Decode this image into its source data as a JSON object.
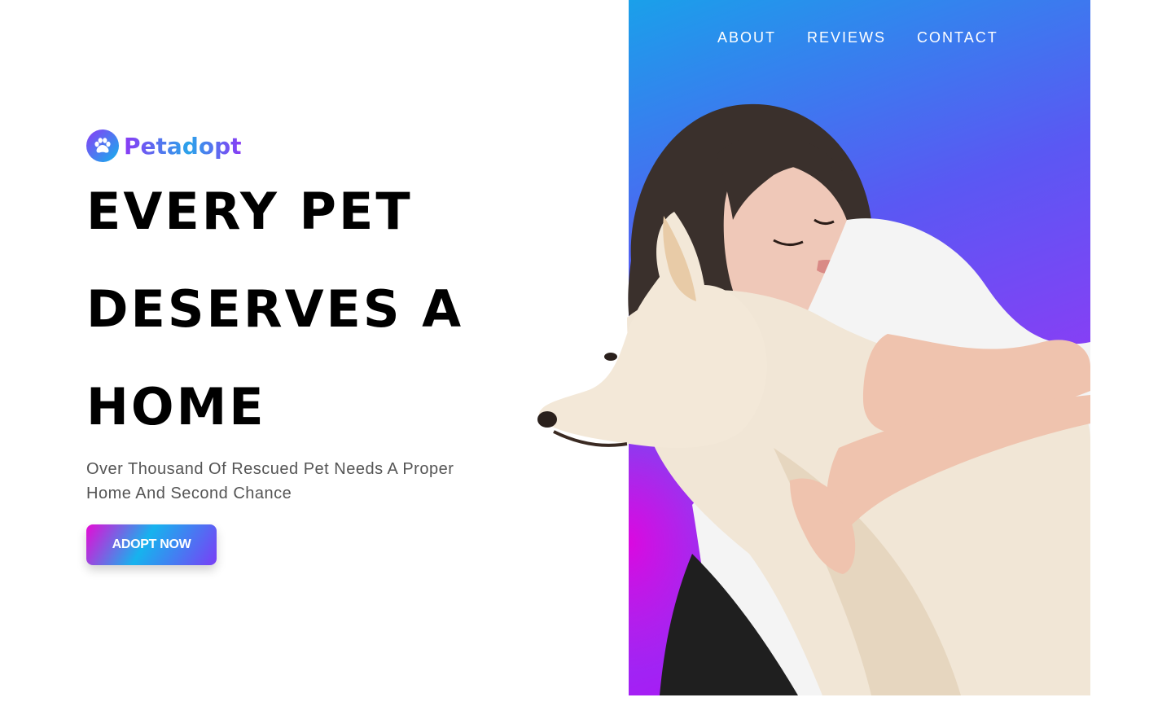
{
  "nav": {
    "items": [
      {
        "label": "ABOUT"
      },
      {
        "label": "REVIEWS"
      },
      {
        "label": "CONTACT"
      }
    ]
  },
  "brand": {
    "name": "Petadopt",
    "icon": "paw-icon"
  },
  "hero": {
    "headline_lines": [
      "EVERY PET",
      "DESERVES A",
      "HOME"
    ],
    "subtitle": "Over Thousand Of Rescued Pet Needs A Proper Home And Second Chance",
    "cta_label": "ADOPT NOW"
  },
  "colors": {
    "accent_purple": "#8a3af5",
    "accent_blue": "#16b3ee",
    "accent_magenta": "#e60ad6",
    "headline": "#000000",
    "subtitle": "#555555"
  }
}
